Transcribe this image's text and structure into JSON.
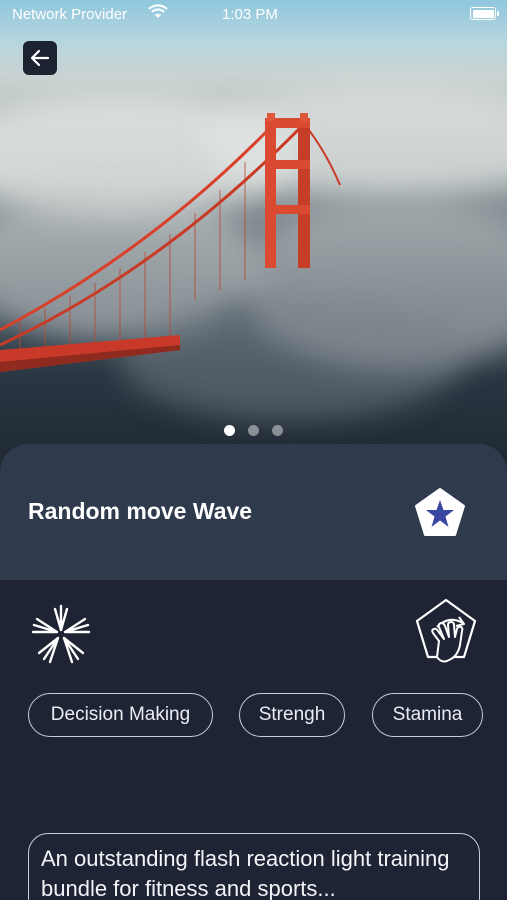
{
  "status_bar": {
    "carrier": "Network Provider",
    "time": "1:03 PM"
  },
  "hero": {
    "carousel_pages": 3,
    "active_page": 1
  },
  "header": {
    "title": "Random move Wave"
  },
  "tags": [
    "Decision Making",
    "Strengh",
    "Stamina"
  ],
  "description": "An outstanding flash reaction light training bundle for fitness and sports...",
  "icons": {
    "back": "back-arrow-icon",
    "favorite": "star-pentagon-icon",
    "brand": "starburst-logo-icon",
    "mode": "touch-hand-icon"
  },
  "colors": {
    "card": "#303a4d",
    "background": "#1e2434",
    "bridge": "#d9402a",
    "star": "#3947a3"
  }
}
